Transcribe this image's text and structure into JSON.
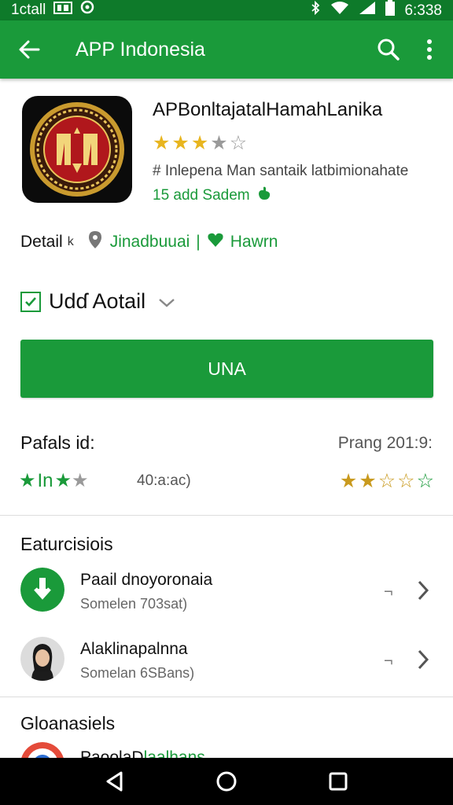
{
  "status": {
    "left_text": "1ctall",
    "time": "6:338"
  },
  "appbar": {
    "title": "APP Indonesia"
  },
  "app": {
    "name": "APBonltajatalHamahLanika",
    "rating_stars": 3,
    "subline": "# Inlepena Man santaik latbimionahate",
    "subline2": "15 add Sadem"
  },
  "detail": {
    "label": "Detail",
    "label_suffix": "k",
    "location": "Jinadbuuai",
    "sep": "|",
    "haw": "Hawrn"
  },
  "option": {
    "label": "Udɗ Aotail"
  },
  "install": {
    "label": "UNA"
  },
  "ratings": {
    "title": "Pafals id:",
    "date": "Prang 201:9:",
    "left_text": "In",
    "middle": "40:a:ac)",
    "right_rating": 2.5
  },
  "section1": {
    "title": "Eaturcisiois",
    "items": [
      {
        "title": "Paail dnoyoronaia",
        "subtitle": "Somelen 703sat)",
        "dash": "¬"
      },
      {
        "title": "Alaklinapalnna",
        "subtitle": "Somelan 6SBans)",
        "dash": "¬"
      }
    ]
  },
  "section2": {
    "title": "Gloanasiels",
    "peek_black": "PaoolaD",
    "peek_green": "laalhans"
  },
  "colors": {
    "primary": "#1a9a3a",
    "status": "#0e7a2a",
    "star": "#e8b51f"
  }
}
